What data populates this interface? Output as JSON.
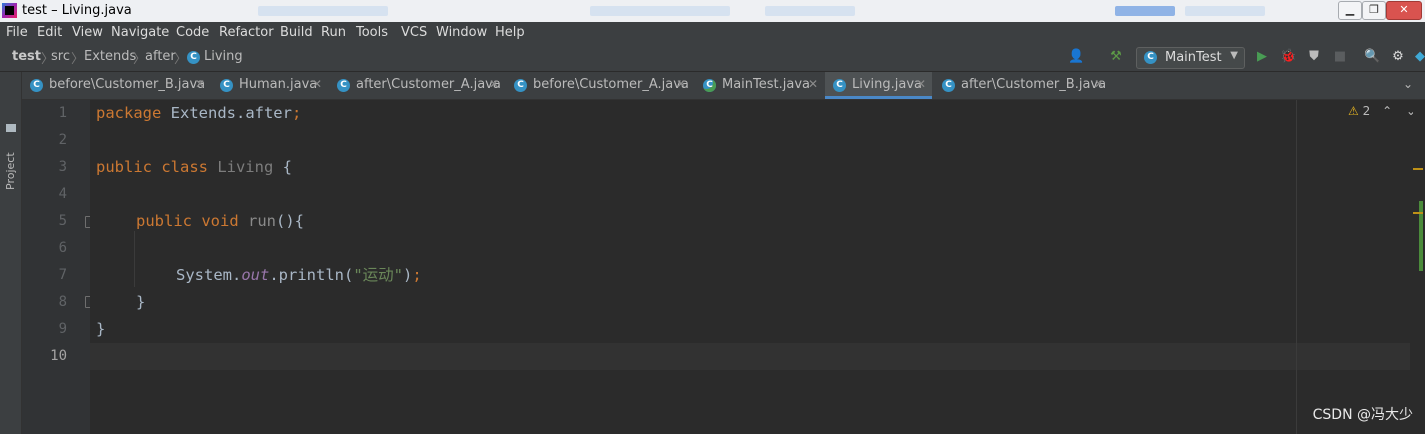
{
  "window": {
    "title": "test – Living.java",
    "controls": [
      "minimize",
      "maximize",
      "close"
    ]
  },
  "menu": [
    "File",
    "Edit",
    "View",
    "Navigate",
    "Code",
    "Refactor",
    "Build",
    "Run",
    "Tools",
    "VCS",
    "Window",
    "Help"
  ],
  "breadcrumb": [
    "test",
    "src",
    "Extends",
    "after",
    "Living"
  ],
  "run_config": "MainTest",
  "sidebar": {
    "project_label": "Project"
  },
  "tabs": [
    {
      "label": "before\\Customer_B.java",
      "active": false
    },
    {
      "label": "Human.java",
      "active": false
    },
    {
      "label": "after\\Customer_A.java",
      "active": false
    },
    {
      "label": "before\\Customer_A.java",
      "active": false
    },
    {
      "label": "MainTest.java",
      "active": false
    },
    {
      "label": "Living.java",
      "active": true
    },
    {
      "label": "after\\Customer_B.java",
      "active": false
    }
  ],
  "editor": {
    "line_numbers": [
      "1",
      "2",
      "3",
      "4",
      "5",
      "6",
      "7",
      "8",
      "9",
      "10"
    ],
    "current_line": "10",
    "code": {
      "l1_kw": "package",
      "l1_rest": " Extends.after",
      "l1_semi": ";",
      "l3_kw": "public class",
      "l3_cls": " Living",
      "l3_rest": " {",
      "l5_kw": "public void",
      "l5_fn": " run",
      "l5_rest": "(){",
      "l7_a": "System.",
      "l7_field": "out",
      "l7_b": ".println(",
      "l7_str": "\"运动\"",
      "l7_c": ")",
      "l7_semi": ";",
      "l8": "}",
      "l9": "}"
    },
    "inspection_warnings": "2"
  },
  "watermark": "CSDN @冯大少",
  "colors": {
    "keyword": "#cc7832",
    "string": "#6a8759",
    "field": "#9876aa",
    "active_tab_underline": "#4a88c7",
    "background": "#2b2b2b"
  }
}
